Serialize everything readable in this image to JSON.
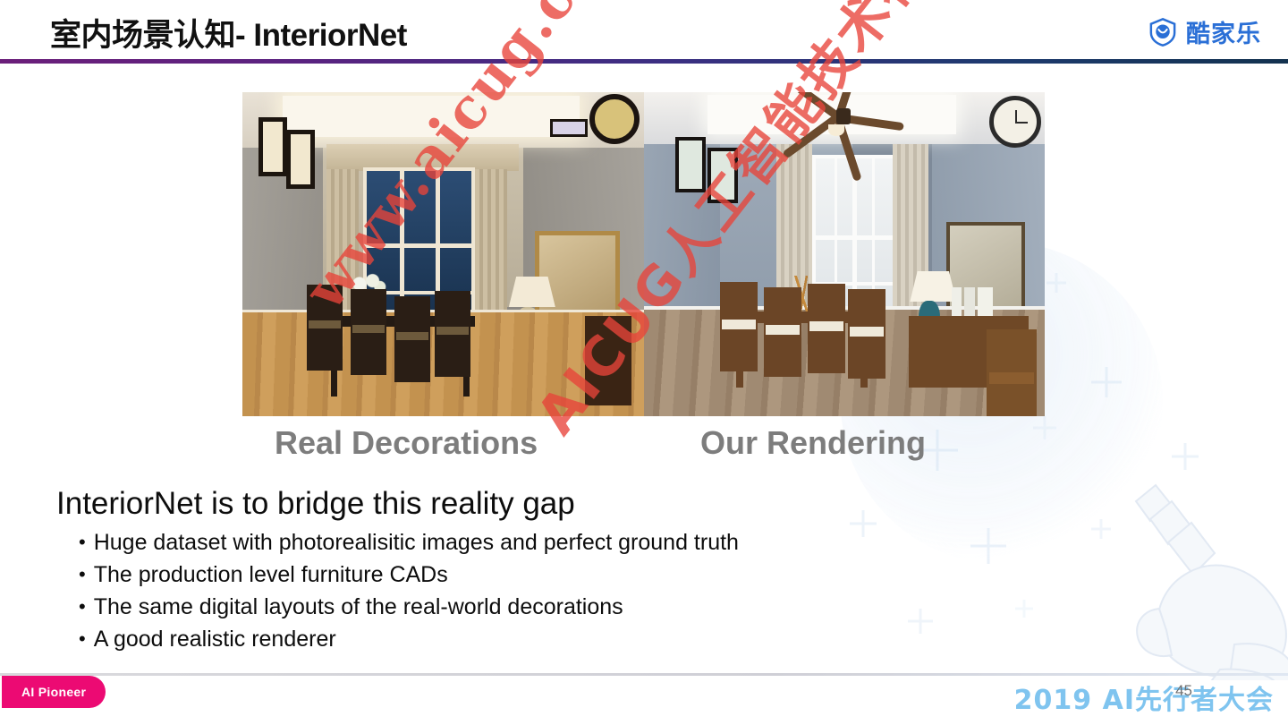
{
  "header": {
    "title_cn": "室内场景认知",
    "title_en": "- InteriorNet",
    "brand_name": "酷家乐",
    "brand_icon": "shield-smile-icon",
    "rule_gradient_from": "#6b1f7a",
    "rule_gradient_to": "#13324f"
  },
  "figure": {
    "left_caption": "Real Decorations",
    "right_caption": "Our Rendering",
    "caption_color": "#7d7d7d",
    "left_photo_alt": "real-decoration-dining-room-photo",
    "right_photo_alt": "rendered-dining-room-image"
  },
  "body": {
    "lead": "InteriorNet is to bridge this reality gap",
    "bullet_marker": "•",
    "bullets": [
      "Huge dataset with photorealisitic images and perfect ground truth",
      "The production level furniture CADs",
      "The same digital layouts of the real-world decorations",
      "A good realistic renderer"
    ]
  },
  "watermark": {
    "line1": "www.aicug.cn",
    "line2": "AICUG人工智能技术社区",
    "color": "#e8443a"
  },
  "footer": {
    "badge_label": "AI Pioneer",
    "badge_color": "#ec0a73",
    "conference": "2019 AI先行者大会",
    "conference_color": "#7fc4ef",
    "page_number": "45"
  }
}
